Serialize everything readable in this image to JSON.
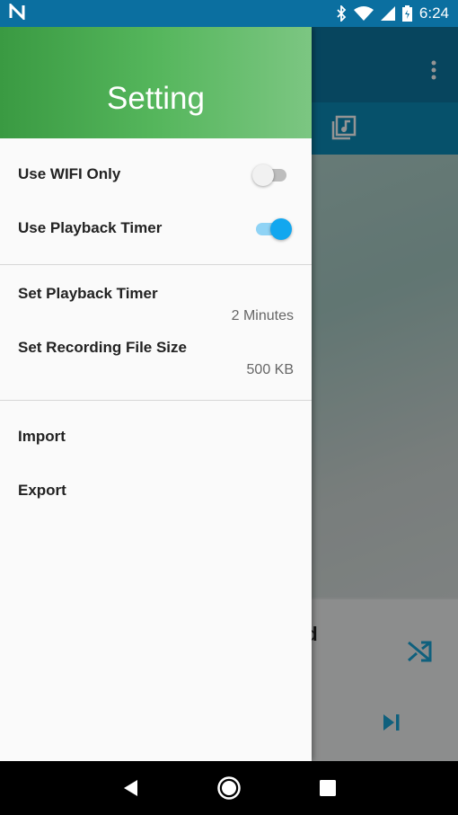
{
  "status_bar": {
    "time": "6:24",
    "icons": [
      "n-logo-icon",
      "bluetooth-icon",
      "wifi-icon",
      "cell-signal-icon",
      "battery-icon"
    ]
  },
  "background": {
    "title_fragment": "ed",
    "icons": [
      "more-vert-icon",
      "music-library-icon",
      "shuffle-icon",
      "skip-next-icon"
    ]
  },
  "drawer": {
    "title": "Setting",
    "toggles": [
      {
        "label": "Use WIFI Only",
        "enabled": false
      },
      {
        "label": "Use Playback Timer",
        "enabled": true
      }
    ],
    "values": [
      {
        "label": "Set Playback Timer",
        "value": "2 Minutes"
      },
      {
        "label": "Set Recording File Size",
        "value": "500 KB"
      }
    ],
    "actions": [
      {
        "label": "Import"
      },
      {
        "label": "Export"
      }
    ]
  },
  "nav_bar": {
    "icons": [
      "back-icon",
      "home-icon",
      "recents-icon"
    ]
  },
  "colors": {
    "header_start": "#3a9a42",
    "header_end": "#7cc682",
    "toggle_on": "#12a7ef",
    "toolbar": "#0d78a3"
  }
}
